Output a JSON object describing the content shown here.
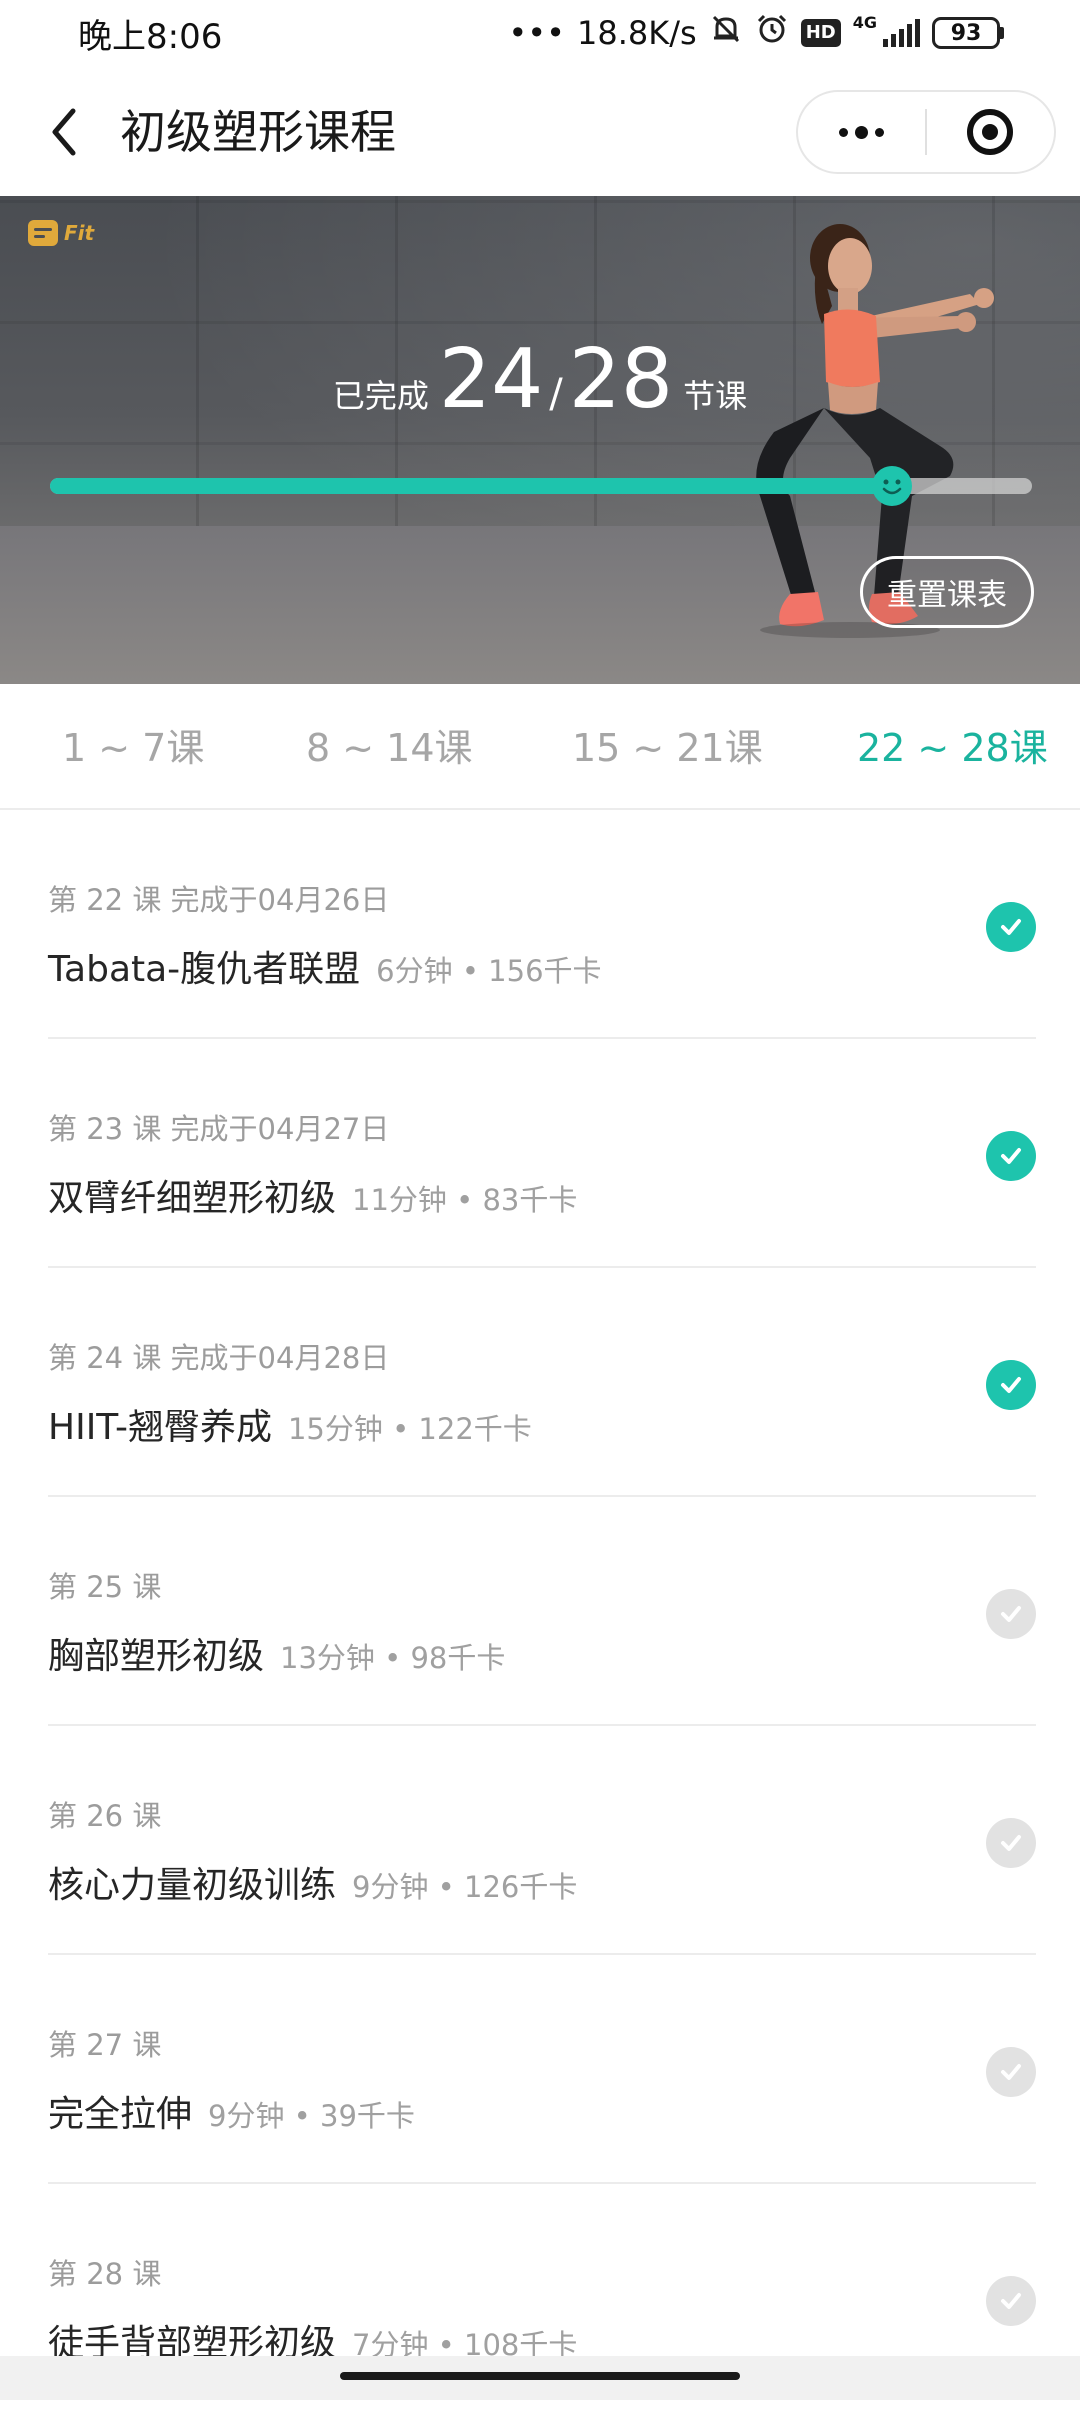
{
  "status_bar": {
    "time": "晚上8:06",
    "network_speed": "18.8K/s",
    "network_type": "4G",
    "hd_label": "HD",
    "battery": "93",
    "icons": [
      "dots-icon",
      "mute-bell-icon",
      "alarm-icon",
      "hd-icon",
      "signal-icon",
      "battery-icon"
    ]
  },
  "nav": {
    "title": "初级塑形课程",
    "back_icon": "chevron-left-icon",
    "more_icon": "more-dots-icon",
    "close_icon": "target-close-icon"
  },
  "hero": {
    "brand_logo": "Fit",
    "completed_prefix": "已完成",
    "completed_count": "24",
    "separator": "/",
    "total_count": "28",
    "completed_suffix": "节课",
    "progress_fraction": 0.857,
    "progress_color": "#1ec4ad",
    "reset_button": "重置课表"
  },
  "tabs": [
    {
      "label": "1 ~ 7课",
      "active": false
    },
    {
      "label": "8 ~ 14课",
      "active": false
    },
    {
      "label": "15 ~ 21课",
      "active": false
    },
    {
      "label": "22 ~ 28课",
      "active": true
    }
  ],
  "lessons": [
    {
      "meta": "第 22 课 完成于04月26日",
      "title": "Tabata-腹仇者联盟",
      "stats": "6分钟 • 156千卡",
      "completed": true
    },
    {
      "meta": "第 23 课 完成于04月27日",
      "title": "双臂纤细塑形初级",
      "stats": "11分钟 • 83千卡",
      "completed": true
    },
    {
      "meta": "第 24 课 完成于04月28日",
      "title": "HIIT-翘臀养成",
      "stats": "15分钟 • 122千卡",
      "completed": true
    },
    {
      "meta": "第 25 课",
      "title": "胸部塑形初级",
      "stats": "13分钟 • 98千卡",
      "completed": false
    },
    {
      "meta": "第 26 课",
      "title": "核心力量初级训练",
      "stats": "9分钟 • 126千卡",
      "completed": false
    },
    {
      "meta": "第 27 课",
      "title": "完全拉伸",
      "stats": "9分钟 • 39千卡",
      "completed": false
    },
    {
      "meta": "第 28 课",
      "title": "徒手背部塑形初级",
      "stats": "7分钟 • 108千卡",
      "completed": false
    }
  ],
  "colors": {
    "accent": "#1ec4ad",
    "tab_active": "#1ab39e",
    "check_pending": "#e2e2e2"
  }
}
